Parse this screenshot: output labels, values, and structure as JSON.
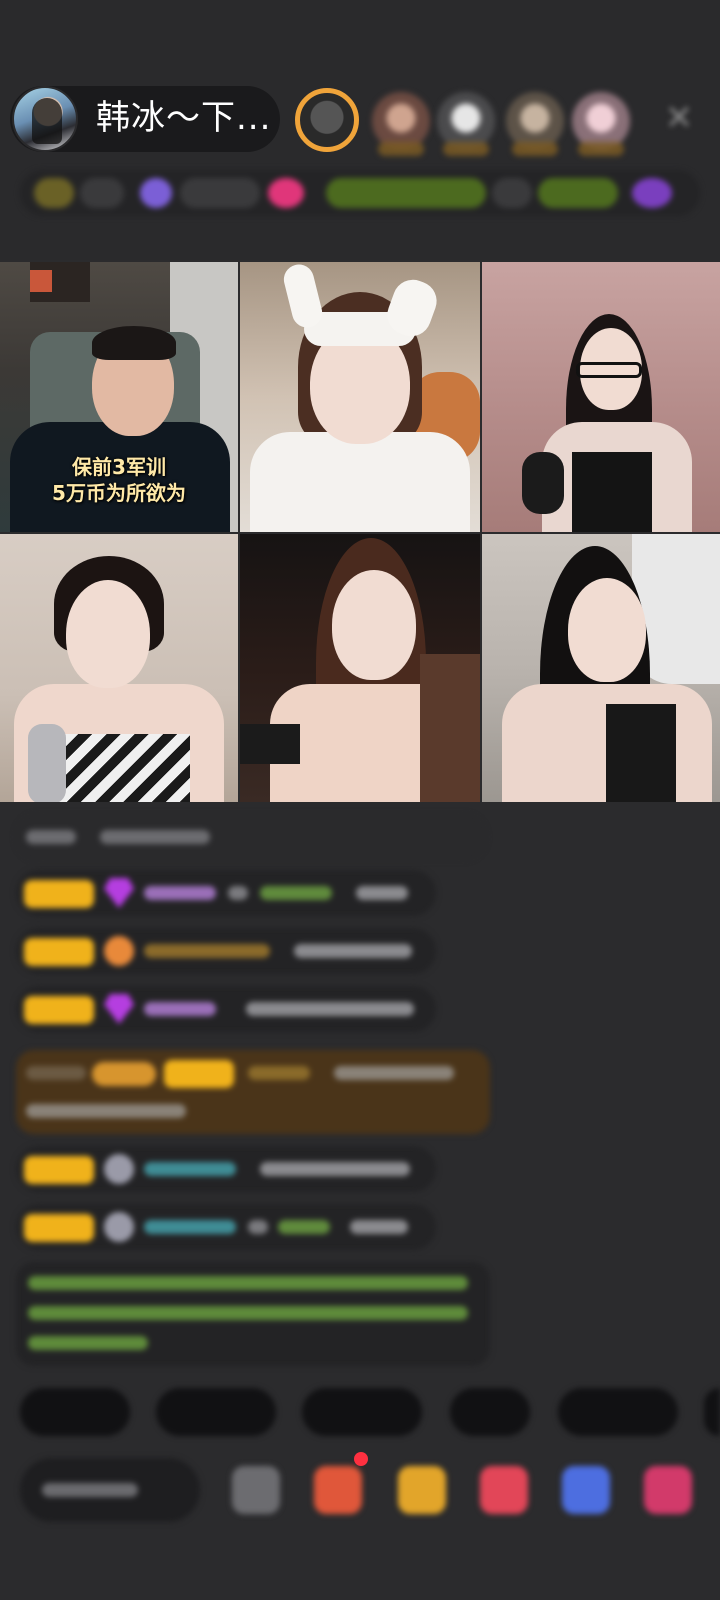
{
  "header": {
    "host_name": "韩冰～下...",
    "close_icon": "close-icon"
  },
  "grid": {
    "tiles": [
      {
        "caption_line1": "保前3军训",
        "caption_line2": "5万币为所欲为"
      },
      {
        "caption_line1": "",
        "caption_line2": ""
      },
      {
        "caption_line1": "",
        "caption_line2": ""
      },
      {
        "caption_line1": "",
        "caption_line2": ""
      },
      {
        "caption_line1": "",
        "caption_line2": ""
      },
      {
        "caption_line1": "",
        "caption_line2": ""
      }
    ]
  },
  "colors": {
    "background": "#2b2b2d",
    "badge_gold": "#f0b21b",
    "system_message": "#4a3419",
    "notice_text": "#7fbf3f"
  }
}
